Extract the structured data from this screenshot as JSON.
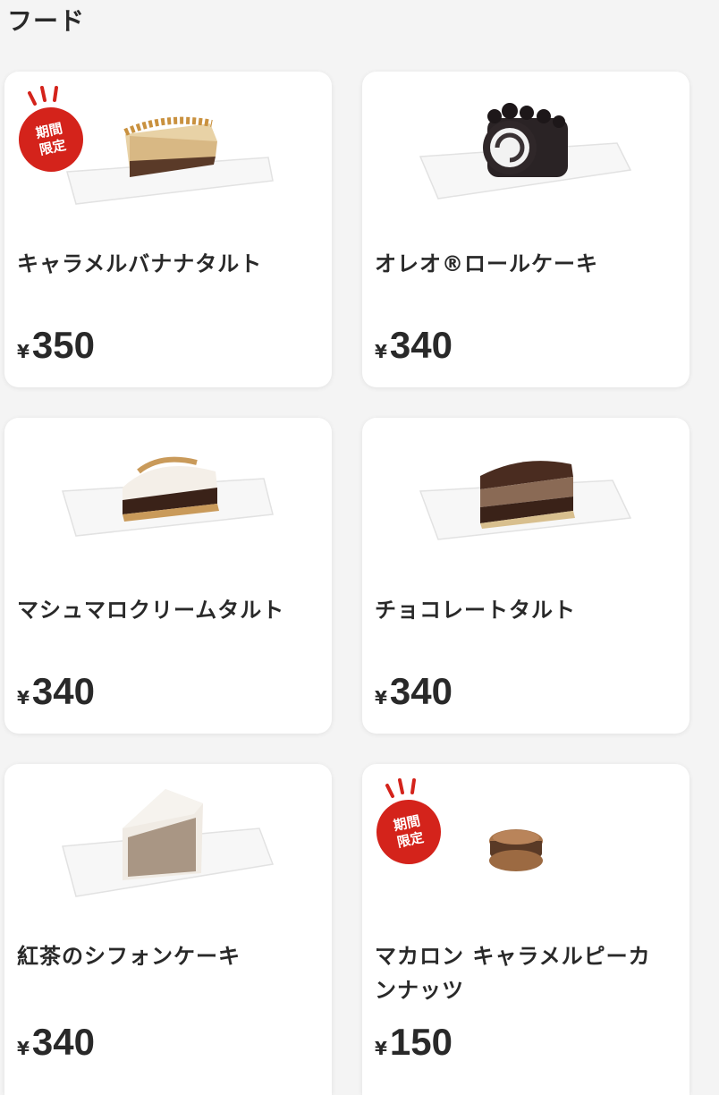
{
  "section": {
    "title": "フード"
  },
  "badge": {
    "line1": "期間",
    "line2": "限定",
    "color": "#d4231b"
  },
  "currency": "¥",
  "products": [
    {
      "name": "キャラメルバナナタルト",
      "price": "350",
      "limited": true,
      "icon": "caramel-banana-tart-image"
    },
    {
      "name": "オレオ®ロールケーキ",
      "price": "340",
      "limited": false,
      "icon": "oreo-roll-cake-image"
    },
    {
      "name": "マシュマロクリームタルト",
      "price": "340",
      "limited": false,
      "icon": "marshmallow-cream-tart-image"
    },
    {
      "name": "チョコレートタルト",
      "price": "340",
      "limited": false,
      "icon": "chocolate-tart-image"
    },
    {
      "name": "紅茶のシフォンケーキ",
      "price": "340",
      "limited": false,
      "icon": "black-tea-chiffon-cake-image"
    },
    {
      "name": "マカロン キャラメルピーカンナッツ",
      "price": "150",
      "limited": true,
      "icon": "macaron-caramel-pecan-image"
    }
  ]
}
